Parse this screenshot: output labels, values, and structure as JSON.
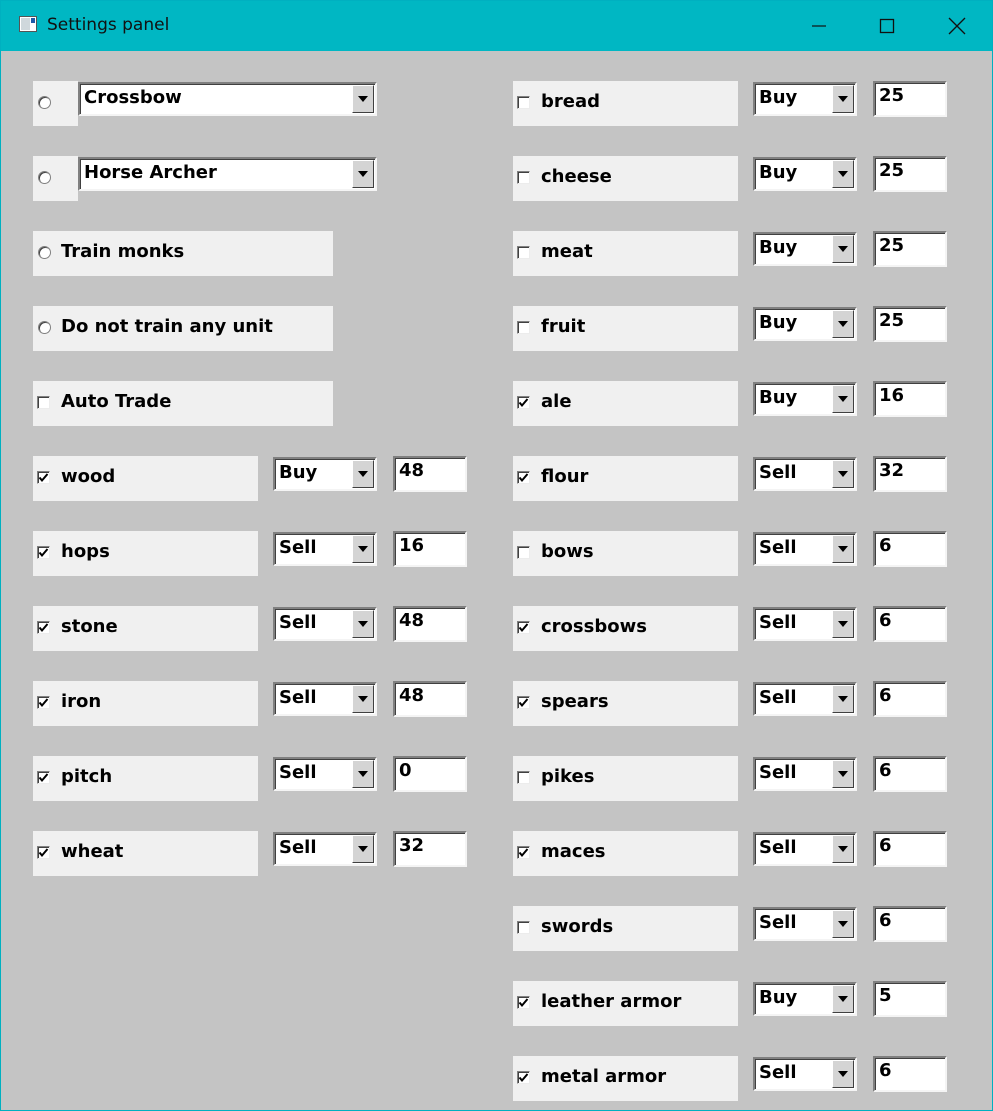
{
  "window": {
    "title": "Settings panel",
    "accent_color": "#00b7c3",
    "panel_color": "#c4c4c4",
    "icons": {
      "app": "window-app-icon",
      "minimize": "minimize-icon",
      "maximize": "maximize-icon",
      "close": "close-icon"
    }
  },
  "units": {
    "options": [
      {
        "kind": "dropdown",
        "selected": false,
        "value": "Crossbow"
      },
      {
        "kind": "dropdown",
        "selected": false,
        "value": "Horse Archer"
      },
      {
        "kind": "label",
        "selected": false,
        "label": "Train monks"
      },
      {
        "kind": "label",
        "selected": false,
        "label": "Do not train any unit"
      }
    ]
  },
  "auto_trade": {
    "label": "Auto Trade",
    "checked": false
  },
  "left_goods": [
    {
      "name": "wood",
      "checked": true,
      "mode": "Buy",
      "amount": "48"
    },
    {
      "name": "hops",
      "checked": true,
      "mode": "Sell",
      "amount": "16"
    },
    {
      "name": "stone",
      "checked": true,
      "mode": "Sell",
      "amount": "48"
    },
    {
      "name": "iron",
      "checked": true,
      "mode": "Sell",
      "amount": "48"
    },
    {
      "name": "pitch",
      "checked": true,
      "mode": "Sell",
      "amount": "0"
    },
    {
      "name": "wheat",
      "checked": true,
      "mode": "Sell",
      "amount": "32"
    }
  ],
  "right_goods": [
    {
      "name": "bread",
      "checked": false,
      "mode": "Buy",
      "amount": "25"
    },
    {
      "name": "cheese",
      "checked": false,
      "mode": "Buy",
      "amount": "25"
    },
    {
      "name": "meat",
      "checked": false,
      "mode": "Buy",
      "amount": "25"
    },
    {
      "name": "fruit",
      "checked": false,
      "mode": "Buy",
      "amount": "25"
    },
    {
      "name": "ale",
      "checked": true,
      "mode": "Buy",
      "amount": "16"
    },
    {
      "name": "flour",
      "checked": true,
      "mode": "Sell",
      "amount": "32"
    },
    {
      "name": "bows",
      "checked": false,
      "mode": "Sell",
      "amount": "6"
    },
    {
      "name": "crossbows",
      "checked": true,
      "mode": "Sell",
      "amount": "6"
    },
    {
      "name": "spears",
      "checked": true,
      "mode": "Sell",
      "amount": "6"
    },
    {
      "name": "pikes",
      "checked": false,
      "mode": "Sell",
      "amount": "6"
    },
    {
      "name": "maces",
      "checked": true,
      "mode": "Sell",
      "amount": "6"
    },
    {
      "name": "swords",
      "checked": false,
      "mode": "Sell",
      "amount": "6"
    },
    {
      "name": "leather armor",
      "checked": true,
      "mode": "Buy",
      "amount": "5"
    },
    {
      "name": "metal armor",
      "checked": true,
      "mode": "Sell",
      "amount": "6"
    }
  ]
}
